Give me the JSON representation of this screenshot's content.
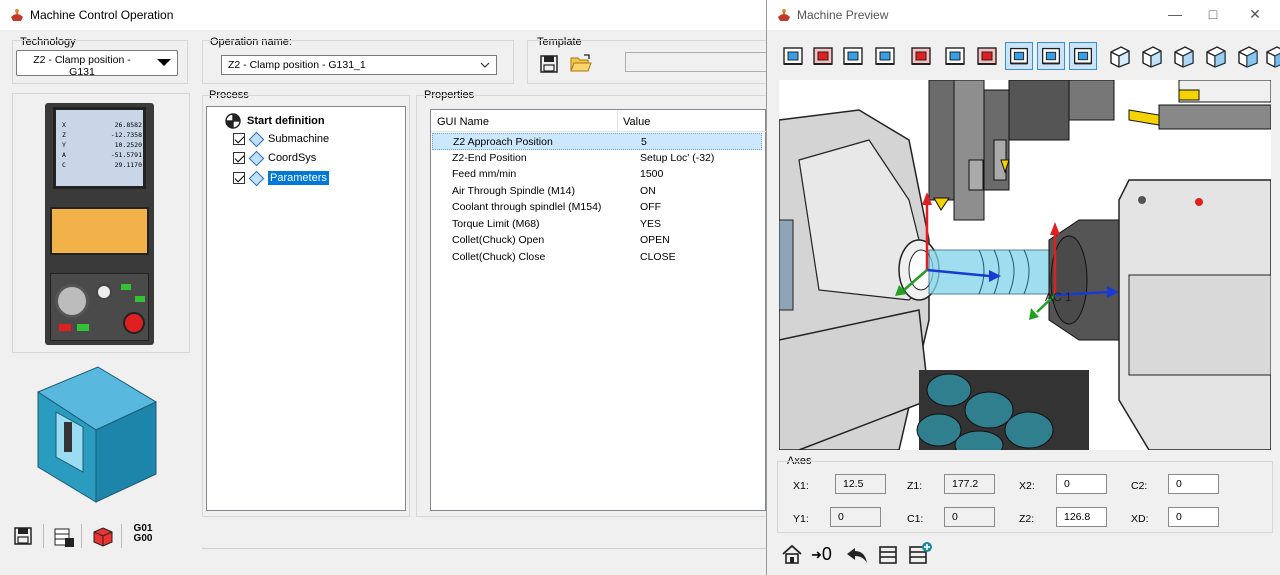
{
  "main": {
    "title": "Machine Control Operation",
    "technology": {
      "label": "Technology",
      "value": "Z2 - Clamp position - G131"
    },
    "operation_name": {
      "label": "Operation name:",
      "value": "Z2 - Clamp position - G131_1"
    },
    "template": {
      "label": "Template",
      "value": ""
    },
    "process": {
      "label": "Process",
      "root": "Start definition",
      "items": [
        "Submachine",
        "CoordSys",
        "Parameters"
      ]
    },
    "properties": {
      "label": "Properties",
      "col_name": "GUI Name",
      "col_value": "Value",
      "rows": [
        {
          "name": "Z2 Approach Position",
          "value": "5"
        },
        {
          "name": "Z2-End Position",
          "value": "Setup Loc' (-32)"
        },
        {
          "name": "Feed mm/min",
          "value": "1500"
        },
        {
          "name": "Air Through Spindle (M14)",
          "value": "ON"
        },
        {
          "name": "Coolant through spindlel (M154)",
          "value": "OFF"
        },
        {
          "name": "Torque Limit (M68)",
          "value": "YES"
        },
        {
          "name": "Collet(Chuck) Open",
          "value": "OPEN"
        },
        {
          "name": "Collet(Chuck) Close",
          "value": "CLOSE"
        }
      ]
    },
    "controller_screen": [
      {
        "axis": "X",
        "value": "26.8582"
      },
      {
        "axis": "Z",
        "value": "-12.7358"
      },
      {
        "axis": "Y",
        "value": "10.2520"
      },
      {
        "axis": "A",
        "value": "-51.5791"
      },
      {
        "axis": "C",
        "value": "29.1170"
      }
    ],
    "gcode_button": {
      "line1": "G01",
      "line2": "G00"
    }
  },
  "preview": {
    "title": "Machine Preview",
    "axes": {
      "label": "Axes",
      "fields": {
        "x1": {
          "label": "X1:",
          "value": "12.5"
        },
        "y1": {
          "label": "Y1:",
          "value": "0"
        },
        "z1": {
          "label": "Z1:",
          "value": "177.2"
        },
        "c1": {
          "label": "C1:",
          "value": "0"
        },
        "x2": {
          "label": "X2:",
          "value": "0"
        },
        "z2": {
          "label": "Z2:",
          "value": "126.8"
        },
        "c2": {
          "label": "C2:",
          "value": "0"
        },
        "xd": {
          "label": "XD:",
          "value": "0"
        }
      }
    },
    "viewport_label": "AC 1",
    "zero_label": "0"
  },
  "colors": {
    "selection": "#cce8ff",
    "accent": "#0078d7",
    "machine_teal": "#2a9cbf"
  }
}
